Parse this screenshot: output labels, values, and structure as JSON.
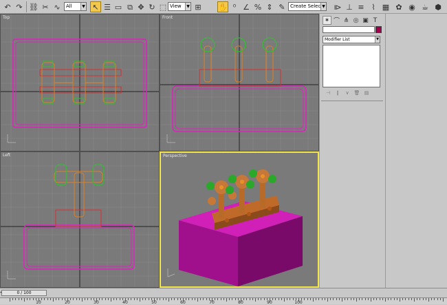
{
  "toolbar": {
    "icons": [
      "undo-icon",
      "redo-icon",
      "link-icon",
      "unlink-icon",
      "bind-spacewarp-icon",
      "select-icon",
      "select-by-name-icon",
      "rect-region-icon",
      "window-crossing-icon",
      "move-icon",
      "rotate-icon",
      "scale-icon",
      "select-manipulate-icon",
      "snap-icon",
      "angle-snap-icon",
      "percent-snap-icon",
      "spinner-snap-icon",
      "named-selection-icon",
      "mirror-icon",
      "align-icon",
      "layer-manager-icon",
      "curve-editor-icon",
      "schematic-view-icon",
      "material-editor-icon",
      "render-scene-icon",
      "quick-render-icon",
      "render-type-icon"
    ],
    "selection_filter": "All",
    "ref_coord": "View",
    "named_selection": "Create Selection Set"
  },
  "viewports": {
    "top_label": "Top",
    "front_label": "Front",
    "left_label": "Left",
    "perspective_label": "Perspective"
  },
  "command_panel": {
    "tabs": [
      "create-tab-icon",
      "modify-tab-icon",
      "hierarchy-tab-icon",
      "motion-tab-icon",
      "display-tab-icon",
      "utilities-tab-icon"
    ],
    "name_value": "",
    "object_color": "#a0004a",
    "modifier_list": "Modifier List"
  },
  "timeline": {
    "slider_text": "0 / 100",
    "ticks": [
      "10",
      "20",
      "30",
      "40",
      "50",
      "60",
      "70",
      "80",
      "90",
      "100"
    ]
  }
}
